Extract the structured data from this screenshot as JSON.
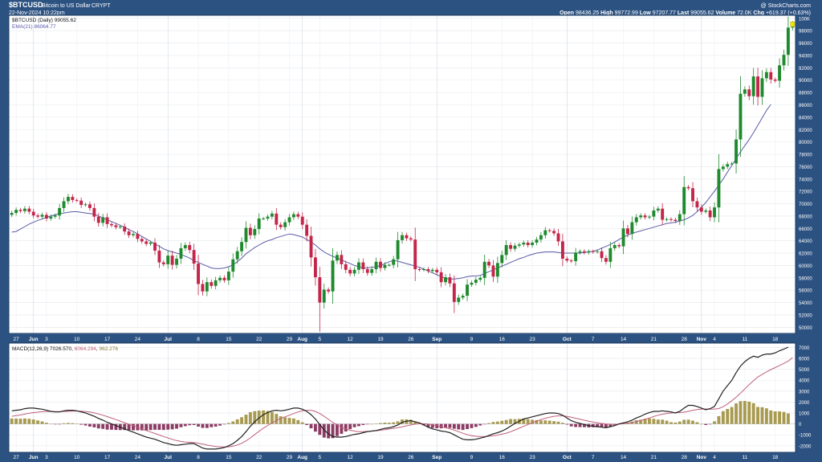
{
  "header": {
    "symbol": "$BTCUSD",
    "name": "Bitcoin to US Dollar",
    "exchange": "CRYPT",
    "date": "22-Nov-2024 10:22pm",
    "watermark": "@ StockCharts.com",
    "quote": {
      "open_label": "Open",
      "open": "98436.25",
      "high_label": "High",
      "high": "99772.99",
      "low_label": "Low",
      "low": "97207.77",
      "last_label": "Last",
      "last": "99055.62",
      "volume_label": "Volume",
      "volume": "72.0K",
      "chg_label": "Chg",
      "chg": "+619.37 (+0.63%)"
    }
  },
  "colors": {
    "frame": "#2c5282",
    "up": "#1f8a2e",
    "down": "#c4264a",
    "ema": "#5a5aa8",
    "macd_line": "#222222",
    "signal_line": "#c0607a",
    "hist_pos": "#a89a50",
    "hist_neg": "#8c3c64",
    "last_marker": "#f2e600"
  },
  "icons": {
    "watermark": "stockcharts-logo-icon"
  },
  "chart_data": [
    {
      "type": "candlestick",
      "legend": [
        "$BTCUSD (Daily) 99055.62",
        "EMA(21) 86064.77"
      ],
      "yticks": [
        "100K",
        "98000",
        "96000",
        "94000",
        "92000",
        "90000",
        "88000",
        "86000",
        "84000",
        "82000",
        "80000",
        "78000",
        "76000",
        "74000",
        "72000",
        "70000",
        "68000",
        "66000",
        "64000",
        "62000",
        "60000",
        "58000",
        "56000",
        "54000",
        "52000",
        "50000"
      ],
      "ylim": [
        49000,
        100500
      ],
      "xticks": [
        {
          "label": "27",
          "i": 1
        },
        {
          "label": "Jun",
          "i": 5,
          "month": true
        },
        {
          "label": "3",
          "i": 8
        },
        {
          "label": "10",
          "i": 15
        },
        {
          "label": "17",
          "i": 22
        },
        {
          "label": "24",
          "i": 29
        },
        {
          "label": "Jul",
          "i": 36,
          "month": true
        },
        {
          "label": "8",
          "i": 43
        },
        {
          "label": "15",
          "i": 50
        },
        {
          "label": "22",
          "i": 57
        },
        {
          "label": "29",
          "i": 64
        },
        {
          "label": "Aug",
          "i": 67,
          "month": true
        },
        {
          "label": "5",
          "i": 71
        },
        {
          "label": "12",
          "i": 78
        },
        {
          "label": "19",
          "i": 85
        },
        {
          "label": "26",
          "i": 92
        },
        {
          "label": "Sep",
          "i": 98,
          "month": true
        },
        {
          "label": "9",
          "i": 106
        },
        {
          "label": "16",
          "i": 113
        },
        {
          "label": "23",
          "i": 120
        },
        {
          "label": "Oct",
          "i": 128,
          "month": true
        },
        {
          "label": "7",
          "i": 134
        },
        {
          "label": "14",
          "i": 141
        },
        {
          "label": "21",
          "i": 148
        },
        {
          "label": "28",
          "i": 155
        },
        {
          "label": "Nov",
          "i": 159,
          "month": true
        },
        {
          "label": "4",
          "i": 162
        },
        {
          "label": "11",
          "i": 169
        },
        {
          "label": "18",
          "i": 176
        }
      ],
      "closes": [
        68500,
        69000,
        68800,
        69200,
        68700,
        68100,
        67900,
        68200,
        67600,
        67900,
        68100,
        69300,
        70400,
        71100,
        70600,
        70500,
        69800,
        69900,
        69300,
        67900,
        66900,
        67800,
        66700,
        66500,
        66200,
        66300,
        65500,
        64900,
        65100,
        64300,
        63900,
        63500,
        63700,
        62400,
        60500,
        60200,
        61600,
        60100,
        61100,
        62800,
        63300,
        62500,
        60300,
        57000,
        55800,
        57300,
        56700,
        57600,
        58000,
        57600,
        59000,
        61000,
        62300,
        63800,
        66100,
        64900,
        65900,
        67600,
        67600,
        67900,
        68400,
        66600,
        66200,
        67000,
        67800,
        68300,
        67900,
        66600,
        64800,
        61300,
        58100,
        54000,
        56100,
        55800,
        60800,
        61700,
        60200,
        59300,
        58700,
        59300,
        60500,
        59400,
        58800,
        59400,
        60600,
        59600,
        60100,
        60100,
        61000,
        64100,
        64900,
        64400,
        64200,
        59400,
        59300,
        59400,
        59100,
        59300,
        58900,
        57300,
        58100,
        57100,
        54100,
        54800,
        55100,
        56900,
        57200,
        57700,
        58000,
        60600,
        60000,
        58200,
        60400,
        61700,
        63300,
        62700,
        63200,
        63400,
        63700,
        63300,
        63700,
        64200,
        64900,
        65700,
        65600,
        65200,
        63900,
        61100,
        60800,
        60700,
        62100,
        62300,
        62100,
        62300,
        62200,
        62300,
        61200,
        60600,
        62800,
        63300,
        63100,
        66000,
        65100,
        67000,
        67800,
        68100,
        67800,
        67900,
        68900,
        69200,
        67400,
        67500,
        67400,
        67200,
        68300,
        72700,
        72500,
        70400,
        69400,
        68700,
        68900,
        67800,
        69400,
        75600,
        76000,
        76400,
        76500,
        80400,
        87800,
        88500,
        87400,
        90600,
        87300,
        90300,
        91300,
        90100,
        89900,
        92400,
        94100,
        98500,
        99100
      ],
      "ema": [
        65400,
        65500,
        65900,
        66300,
        66700,
        67000,
        67300,
        67500,
        67800,
        68000,
        68200,
        68400,
        68500,
        68600,
        68700,
        68700,
        68600,
        68500,
        68400,
        68300,
        68000,
        67700,
        67400,
        67100,
        66800,
        66500,
        66200,
        65800,
        65500,
        65100,
        64700,
        64300,
        63900,
        63500,
        63100,
        62700,
        62400,
        62200,
        62000,
        61800,
        61500,
        61200,
        60800,
        60500,
        60200,
        59900,
        59600,
        59500,
        59500,
        59600,
        59800,
        60100,
        60600,
        61200,
        61900,
        62400,
        62900,
        63300,
        63700,
        64000,
        64200,
        64500,
        64700,
        64900,
        65100,
        65000,
        64800,
        64600,
        64200,
        63800,
        63300,
        62700,
        62200,
        61800,
        61500,
        61200,
        60900,
        60600,
        60300,
        60000,
        59800,
        59600,
        59600,
        59700,
        59800,
        60000,
        60300,
        60600,
        60800,
        60700,
        60500,
        60300,
        60100,
        59900,
        59700,
        59400,
        59100,
        58800,
        58500,
        58200,
        57900,
        57800,
        57800,
        57900,
        58000,
        58200,
        58300,
        58300,
        58400,
        58700,
        59000,
        59300,
        59600,
        59900,
        60200,
        60500,
        60800,
        61100,
        61300,
        61600,
        61800,
        62000,
        62100,
        62200,
        62200,
        62200,
        62100,
        62000,
        62000,
        62000,
        62000,
        62000,
        62100,
        62200,
        62300,
        62500,
        62800,
        63100,
        63400,
        63800,
        64200,
        64600,
        64900,
        65200,
        65400,
        65600,
        65800,
        66000,
        66200,
        66400,
        66600,
        66800,
        66900,
        67000,
        67200,
        67400,
        67700,
        68100,
        68700,
        69400,
        70200,
        71100,
        72000,
        73000,
        74000,
        75100,
        76200,
        77300,
        78400,
        79400,
        80400,
        81500,
        82700,
        83900,
        85100,
        86064.77
      ],
      "last": 99055.62
    },
    {
      "type": "line+histogram",
      "title": "MACD(12,26,9)",
      "legend_values": [
        "7026.570",
        "6064.294",
        "962.276"
      ],
      "yticks": [
        "7000",
        "6000",
        "5000",
        "4000",
        "3000",
        "2000",
        "1000",
        "0",
        "-1000",
        "-2000"
      ],
      "ylim": [
        -2600,
        7400
      ],
      "series": [
        {
          "name": "MACD",
          "values": [
            1200,
            1250,
            1300,
            1400,
            1450,
            1450,
            1400,
            1350,
            1250,
            1150,
            1100,
            1100,
            1200,
            1250,
            1250,
            1200,
            1100,
            1000,
            850,
            700,
            500,
            350,
            150,
            0,
            -150,
            -300,
            -450,
            -600,
            -750,
            -900,
            -1050,
            -1200,
            -1300,
            -1400,
            -1550,
            -1700,
            -1800,
            -1900,
            -1950,
            -1900,
            -1850,
            -1800,
            -1800,
            -2000,
            -2200,
            -2300,
            -2300,
            -2300,
            -2250,
            -2150,
            -2000,
            -1800,
            -1500,
            -1150,
            -700,
            -200,
            200,
            550,
            850,
            1050,
            1200,
            1250,
            1200,
            1250,
            1350,
            1450,
            1450,
            1350,
            1150,
            850,
            450,
            -50,
            -550,
            -900,
            -1150,
            -1200,
            -1200,
            -1150,
            -1050,
            -950,
            -900,
            -800,
            -700,
            -650,
            -600,
            -500,
            -400,
            -350,
            -250,
            -100,
            150,
            250,
            300,
            200,
            100,
            -100,
            -300,
            -450,
            -550,
            -650,
            -700,
            -800,
            -1000,
            -1200,
            -1400,
            -1450,
            -1450,
            -1400,
            -1300,
            -1200,
            -1050,
            -900,
            -800,
            -650,
            -450,
            -200,
            50,
            250,
            450,
            550,
            650,
            750,
            850,
            950,
            1000,
            1000,
            950,
            800,
            550,
            300,
            150,
            50,
            -50,
            -150,
            -200,
            -250,
            -300,
            -350,
            -250,
            -150,
            0,
            100,
            200,
            350,
            550,
            700,
            900,
            1050,
            1150,
            1150,
            1200,
            1150,
            1100,
            1000,
            1150,
            1450,
            1700,
            1700,
            1600,
            1450,
            1300,
            1400,
            1600,
            2300,
            3000,
            3500,
            4000,
            4700,
            5300,
            5700,
            6000,
            6200,
            6100,
            6300,
            6400,
            6400,
            6500,
            6700,
            6850,
            7026.57
          ]
        },
        {
          "name": "Signal",
          "values": [
            700,
            760,
            820,
            900,
            980,
            1040,
            1080,
            1120,
            1140,
            1140,
            1130,
            1130,
            1140,
            1160,
            1180,
            1180,
            1170,
            1140,
            1090,
            1010,
            910,
            800,
            670,
            530,
            400,
            260,
            110,
            -30,
            -170,
            -320,
            -460,
            -600,
            -740,
            -870,
            -1010,
            -1150,
            -1280,
            -1410,
            -1520,
            -1600,
            -1650,
            -1680,
            -1700,
            -1760,
            -1840,
            -1930,
            -2000,
            -2060,
            -2100,
            -2110,
            -2090,
            -2030,
            -1920,
            -1770,
            -1550,
            -1280,
            -970,
            -670,
            -390,
            -140,
            100,
            330,
            500,
            650,
            800,
            950,
            1100,
            1200,
            1250,
            1250,
            1150,
            950,
            700,
            420,
            150,
            -90,
            -300,
            -460,
            -580,
            -650,
            -700,
            -700,
            -680,
            -650,
            -620,
            -580,
            -520,
            -460,
            -400,
            -340,
            -260,
            -170,
            -90,
            -20,
            20,
            20,
            -10,
            -80,
            -160,
            -250,
            -340,
            -440,
            -560,
            -700,
            -850,
            -980,
            -1070,
            -1130,
            -1160,
            -1160,
            -1130,
            -1080,
            -1020,
            -940,
            -840,
            -710,
            -550,
            -390,
            -220,
            -50,
            110,
            260,
            400,
            520,
            620,
            700,
            740,
            740,
            690,
            610,
            520,
            430,
            340,
            250,
            170,
            100,
            50,
            0,
            -30,
            -40,
            -20,
            20,
            70,
            130,
            210,
            310,
            420,
            550,
            680,
            800,
            890,
            960,
            1000,
            1030,
            1040,
            1080,
            1160,
            1250,
            1320,
            1360,
            1370,
            1350,
            1360,
            1410,
            1580,
            1830,
            2130,
            2450,
            2820,
            3210,
            3600,
            3960,
            4300,
            4540,
            4770,
            4970,
            5160,
            5350,
            5550,
            5750,
            6064.294
          ]
        },
        {
          "name": "Histogram",
          "values": [
            500,
            490,
            480,
            500,
            470,
            410,
            320,
            230,
            110,
            10,
            -30,
            -30,
            60,
            90,
            70,
            20,
            -70,
            -140,
            -240,
            -310,
            -410,
            -450,
            -520,
            -530,
            -550,
            -560,
            -560,
            -570,
            -580,
            -580,
            -590,
            -600,
            -560,
            -530,
            -540,
            -550,
            -520,
            -490,
            -430,
            -300,
            -200,
            -120,
            -100,
            -240,
            -360,
            -370,
            -300,
            -240,
            -150,
            -40,
            90,
            230,
            420,
            620,
            850,
            1080,
            1170,
            1220,
            1240,
            1190,
            1100,
            920,
            700,
            600,
            550,
            500,
            350,
            150,
            -100,
            -400,
            -700,
            -1000,
            -1250,
            -1320,
            -1300,
            -1110,
            -900,
            -690,
            -470,
            -300,
            -200,
            -100,
            -20,
            0,
            20,
            80,
            120,
            110,
            150,
            240,
            410,
            420,
            390,
            220,
            80,
            -120,
            -290,
            -370,
            -390,
            -400,
            -360,
            -360,
            -440,
            -500,
            -550,
            -470,
            -380,
            -270,
            -140,
            -40,
            80,
            180,
            220,
            290,
            360,
            450,
            440,
            470,
            500,
            440,
            390,
            350,
            330,
            330,
            300,
            260,
            210,
            110,
            -60,
            -220,
            -280,
            -290,
            -300,
            -320,
            -300,
            -300,
            -300,
            -320,
            -230,
            -130,
            20,
            70,
            130,
            220,
            340,
            390,
            480,
            500,
            470,
            400,
            390,
            300,
            160,
            130,
            220,
            380,
            390,
            300,
            160,
            0,
            -100,
            -20,
            240,
            720,
            1170,
            1370,
            1550,
            1880,
            2090,
            2100,
            2040,
            1900,
            1560,
            1530,
            1430,
            1240,
            1150,
            1150,
            1100,
            962.276
          ]
        }
      ]
    }
  ]
}
